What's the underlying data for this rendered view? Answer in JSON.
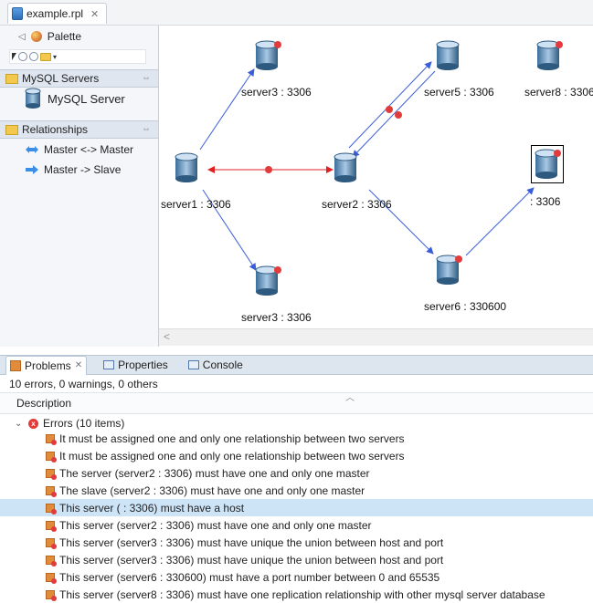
{
  "editor": {
    "tab_title": "example.rpl",
    "tab_close": "✕"
  },
  "palette": {
    "collapse_glyph": "◁",
    "title": "Palette",
    "tools": [
      "select-arrow-icon",
      "zoom-in-icon",
      "zoom-out-icon",
      "note-folder-icon"
    ],
    "drawers": [
      {
        "label": "MySQL Servers",
        "items": [
          {
            "label": "MySQL Server",
            "icon": "mysql-db-icon"
          }
        ]
      },
      {
        "label": "Relationships",
        "items": [
          {
            "label": "Master <-> Master",
            "icon": "double-arrow-icon"
          },
          {
            "label": "Master -> Slave",
            "icon": "arrow-right-icon"
          }
        ]
      }
    ],
    "pin_glyph": "⇔"
  },
  "diagram": {
    "nodes": [
      {
        "id": "server3_top",
        "label": "server3 : 3306",
        "error": true
      },
      {
        "id": "server5",
        "label": "server5 : 3306",
        "error": true
      },
      {
        "id": "server8",
        "label": "server8 : 3306",
        "error": true
      },
      {
        "id": "server1",
        "label": "server1 : 3306",
        "error": false
      },
      {
        "id": "server2",
        "label": "server2 : 3306",
        "error": true
      },
      {
        "id": "selected",
        "label": ": 3306",
        "error": true
      },
      {
        "id": "server3_bottom",
        "label": "server3 : 3306",
        "error": true
      },
      {
        "id": "server6",
        "label": "server6 : 330600",
        "error": true
      }
    ],
    "colors": {
      "master_master": "#e02020",
      "master_slave": "#3a5ed8",
      "error": "#e23b3b"
    }
  },
  "scroll_glyph": "<",
  "bottom": {
    "tabs": [
      {
        "label": "Problems",
        "close": "✕"
      },
      {
        "label": "Properties"
      },
      {
        "label": "Console"
      }
    ],
    "summary": "10 errors, 0 warnings, 0 others",
    "column": "Description",
    "group_label": "Errors (10 items)",
    "rows": [
      "It must be assigned one and only one relationship between two servers",
      "It must be assigned one and only one relationship between two servers",
      "The server (server2 : 3306) must have one and only one master",
      "The slave (server2 : 3306) must have one and only one master",
      "This server ( : 3306) must have a host",
      "This server (server2 : 3306) must have one and only one master",
      "This server (server3 : 3306) must have unique the union between host and port",
      "This server (server3 : 3306) must have unique the union between host and port",
      "This server (server6 : 330600) must have a port number between 0 and 65535",
      "This server (server8 : 3306) must have one replication relationship with other mysql server database"
    ],
    "selected_row": 4
  }
}
